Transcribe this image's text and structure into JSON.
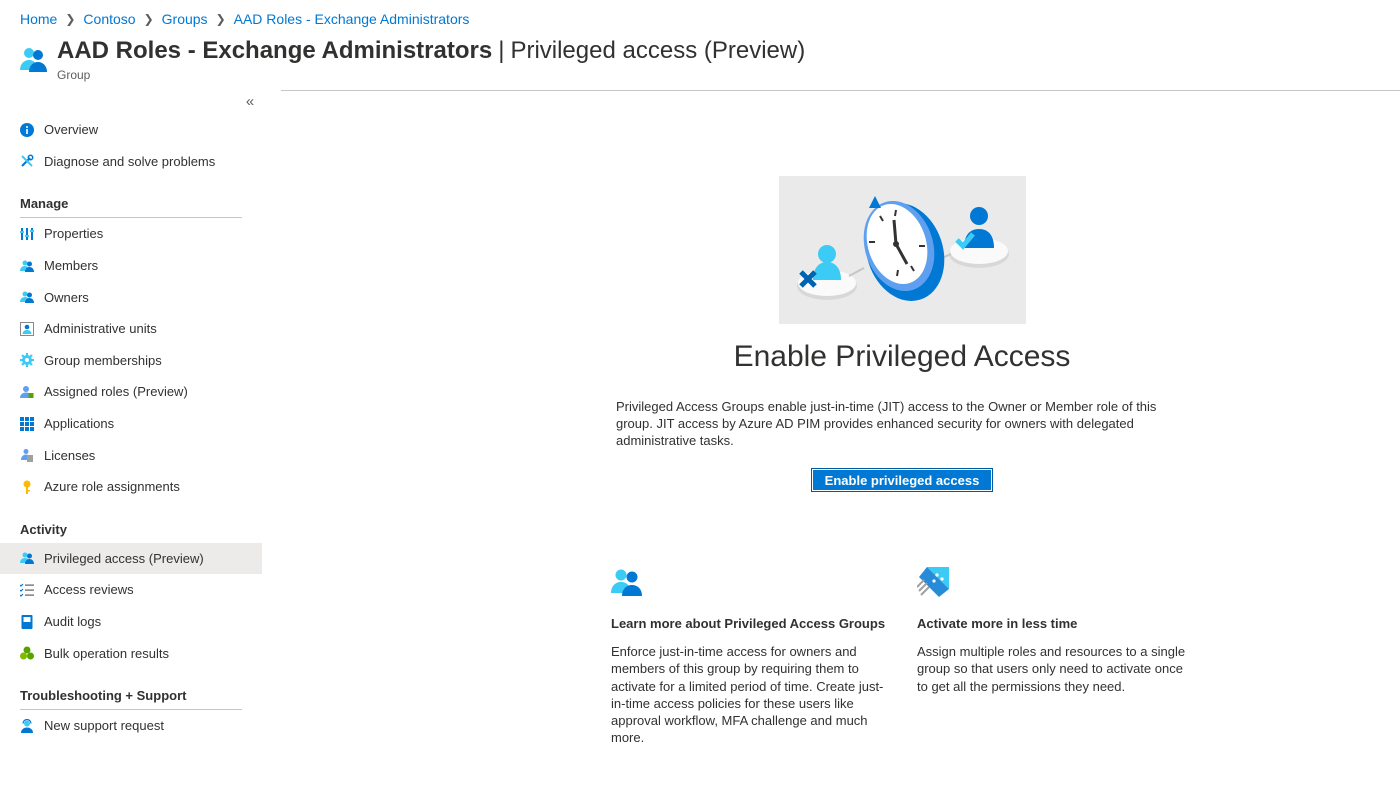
{
  "breadcrumb": [
    "Home",
    "Contoso",
    "Groups",
    "AAD Roles - Exchange Administrators"
  ],
  "header": {
    "title_main": "AAD Roles - Exchange Administrators",
    "title_sep": "|",
    "title_sub": "Privileged access (Preview)",
    "subtitle": "Group",
    "icon": "group-icon"
  },
  "collapse_label": "«",
  "nav": {
    "top": [
      {
        "label": "Overview",
        "icon": "info-icon"
      },
      {
        "label": "Diagnose and solve problems",
        "icon": "wrench-icon"
      }
    ],
    "manage_title": "Manage",
    "manage": [
      {
        "label": "Properties",
        "icon": "properties-icon"
      },
      {
        "label": "Members",
        "icon": "members-icon"
      },
      {
        "label": "Owners",
        "icon": "owners-icon"
      },
      {
        "label": "Administrative units",
        "icon": "admin-units-icon"
      },
      {
        "label": "Group memberships",
        "icon": "gear-icon"
      },
      {
        "label": "Assigned roles (Preview)",
        "icon": "assigned-roles-icon"
      },
      {
        "label": "Applications",
        "icon": "applications-grid-icon"
      },
      {
        "label": "Licenses",
        "icon": "license-icon"
      },
      {
        "label": "Azure role assignments",
        "icon": "key-icon"
      }
    ],
    "activity_title": "Activity",
    "activity": [
      {
        "label": "Privileged access (Preview)",
        "icon": "privileged-access-icon",
        "active": true
      },
      {
        "label": "Access reviews",
        "icon": "checklist-icon"
      },
      {
        "label": "Audit logs",
        "icon": "book-icon"
      },
      {
        "label": "Bulk operation results",
        "icon": "bulk-icon"
      }
    ],
    "support_title": "Troubleshooting + Support",
    "support": [
      {
        "label": "New support request",
        "icon": "support-person-icon"
      }
    ]
  },
  "main": {
    "title": "Enable Privileged Access",
    "description": "Privileged Access Groups enable just-in-time (JIT) access to the Owner or Member role of this group. JIT access by Azure AD PIM provides enhanced security for owners with delegated administrative tasks.",
    "button_label": "Enable privileged access",
    "hero_icon": "clock-illustration-icon"
  },
  "cards": [
    {
      "icon": "members-icon",
      "title": "Learn more about Privileged Access Groups",
      "body": "Enforce just-in-time access for owners and members of this group by requiring them to activate for a limited period of time. Create just-in-time access policies for these users like approval workflow, MFA challenge and much more."
    },
    {
      "icon": "rocket-icon",
      "title": "Activate more in less time",
      "body": "Assign multiple roles and resources to a single group so that users only need to activate once to get all the permissions they need."
    }
  ],
  "colors": {
    "accent": "#0078d4",
    "active_bg": "#edebe9"
  }
}
